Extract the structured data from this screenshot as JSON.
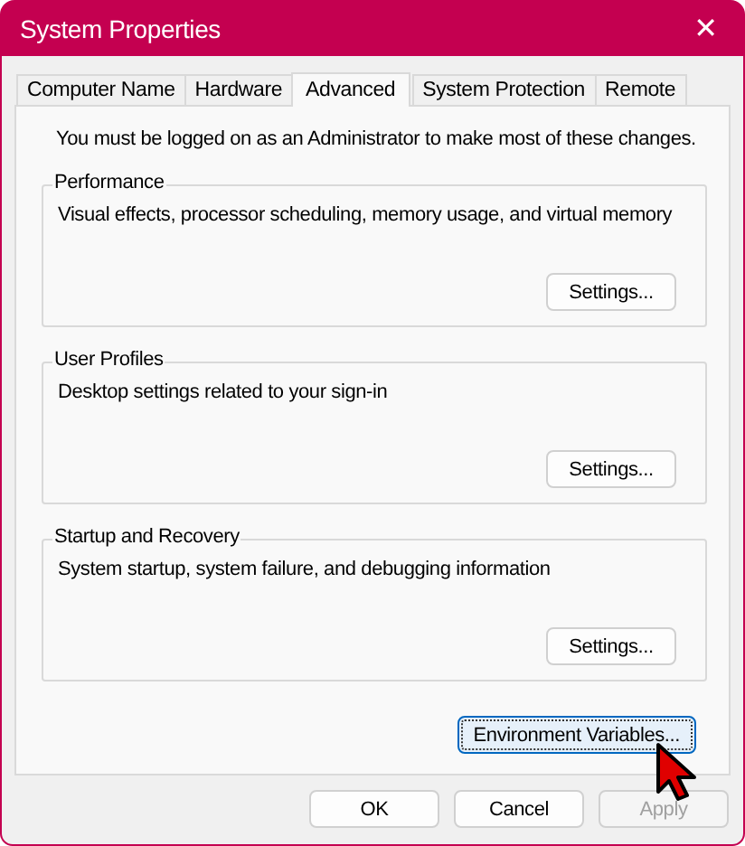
{
  "window": {
    "title": "System Properties",
    "close": "✕"
  },
  "tabs": [
    {
      "label": "Computer Name",
      "selected": false
    },
    {
      "label": "Hardware",
      "selected": false
    },
    {
      "label": "Advanced",
      "selected": true
    },
    {
      "label": "System Protection",
      "selected": false
    },
    {
      "label": "Remote",
      "selected": false
    }
  ],
  "notice": "You must be logged on as an Administrator to make most of these changes.",
  "groups": [
    {
      "title": "Performance",
      "description": "Visual effects, processor scheduling, memory usage, and virtual memory",
      "button": "Settings..."
    },
    {
      "title": "User Profiles",
      "description": "Desktop settings related to your sign-in",
      "button": "Settings..."
    },
    {
      "title": "Startup and Recovery",
      "description": "System startup, system failure, and debugging information",
      "button": "Settings..."
    }
  ],
  "environment_button": {
    "label": "Environment Variables...",
    "focused": true
  },
  "buttons": [
    {
      "label": "OK",
      "disabled": false
    },
    {
      "label": "Cancel",
      "disabled": false
    },
    {
      "label": "Apply",
      "disabled": true
    }
  ]
}
